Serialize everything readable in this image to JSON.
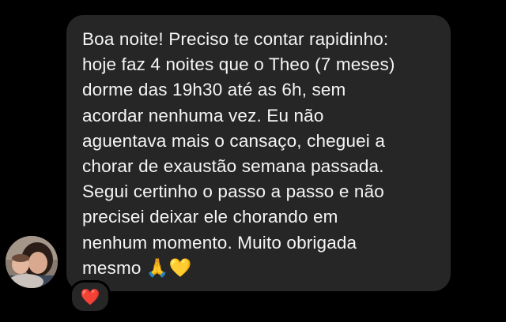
{
  "message": {
    "lines": [
      "Boa noite! Preciso te contar rapidinho:",
      "hoje faz 4 noites que o Theo (7 meses)",
      "dorme das 19h30 até as 6h, sem",
      "acordar nenhuma vez. Eu não",
      "aguentava mais o cansaço, cheguei a",
      "chorar de exaustão semana passada.",
      "Segui certinho o passo a passo e não",
      "precisei deixar ele chorando em",
      "nenhum momento. Muito obrigada",
      "mesmo"
    ],
    "emojis": [
      "🙏",
      "💛"
    ],
    "emoji_names": [
      "folded-hands-icon",
      "yellow-heart-icon"
    ]
  },
  "reaction": {
    "glyph": "❤️",
    "icon": "red-heart-icon",
    "color": "#e8223b"
  },
  "avatar": {
    "icon": "sender-avatar"
  },
  "colors": {
    "background": "#000000",
    "bubble": "#262626",
    "text": "#f5f5f5"
  }
}
